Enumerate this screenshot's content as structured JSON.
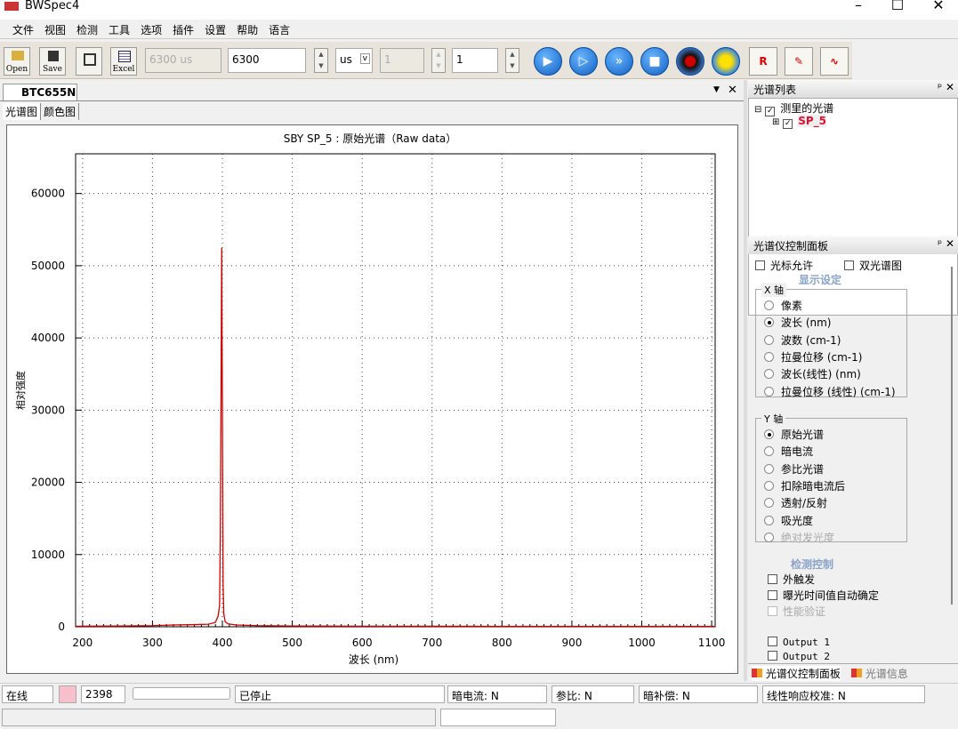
{
  "app": {
    "title": "BWSpec4"
  },
  "menu": [
    "文件",
    "视图",
    "检测",
    "工具",
    "选项",
    "插件",
    "设置",
    "帮助",
    "语言"
  ],
  "toolbar": {
    "open": "Open",
    "save": "Save",
    "excel": "Excel",
    "exposure_display": "6300 us",
    "exposure_value": "6300",
    "unit": "us",
    "avg_disabled": "1",
    "avg_value": "1"
  },
  "doc": {
    "tab": "BTC655N",
    "subtabs": [
      "光谱图",
      "颜色图"
    ]
  },
  "chart_data": {
    "type": "line",
    "title": "SBY  SP_5 : 原始光谱（Raw data）",
    "xlabel": "波长 (nm)",
    "ylabel": "相对强度",
    "xlim": [
      190,
      1105
    ],
    "ylim": [
      0,
      65500
    ],
    "xticks": [
      200,
      300,
      400,
      500,
      600,
      700,
      800,
      900,
      1000,
      1100
    ],
    "yticks": [
      0,
      10000,
      20000,
      30000,
      40000,
      50000,
      60000
    ],
    "grid": true,
    "series": [
      {
        "name": "SP_5",
        "color": "#cc0000",
        "x": [
          190,
          250,
          300,
          330,
          360,
          380,
          390,
          394,
          396,
          397,
          398,
          399,
          400,
          401,
          402,
          404,
          408,
          420,
          450,
          500,
          600,
          700,
          800,
          900,
          1000,
          1105
        ],
        "y": [
          80,
          100,
          150,
          250,
          300,
          350,
          600,
          1500,
          3000,
          12000,
          31000,
          52500,
          30000,
          6000,
          1800,
          700,
          400,
          250,
          150,
          100,
          80,
          70,
          60,
          60,
          60,
          60
        ]
      }
    ]
  },
  "spectrum_list": {
    "title": "光谱列表",
    "root": "测里的光谱",
    "item": "SP_5"
  },
  "control": {
    "title": "光谱仪控制面板",
    "cursor": "光标允许",
    "dual": "双光谱图",
    "display_section": "显示设定",
    "x_axis": {
      "label": "X 轴",
      "options": [
        "像素",
        "波长 (nm)",
        "波数 (cm-1)",
        "拉曼位移 (cm-1)",
        "波长(线性) (nm)",
        "拉曼位移 (线性) (cm-1)"
      ],
      "selected": 1
    },
    "y_axis": {
      "label": "Y 轴",
      "options": [
        "原始光谱",
        "暗电流",
        "参比光谱",
        "扣除暗电流后",
        "透射/反射",
        "吸光度",
        "绝对发光度"
      ],
      "selected": 0
    },
    "detect_section": "检测控制",
    "ext_trigger": "外触发",
    "auto_exposure": "曝光时间值自动确定",
    "perf": "性能验证",
    "out1": "Output 1",
    "out2": "Output 2"
  },
  "bottom_tabs": [
    "光谱仪控制面板",
    "光谱信息"
  ],
  "status": {
    "online": "在线",
    "count": "2398",
    "state": "已停止",
    "dark": "暗电流: N",
    "ref": "参比: N",
    "darkcomp": "暗补偿: N",
    "linear": "线性响应校准: N"
  }
}
